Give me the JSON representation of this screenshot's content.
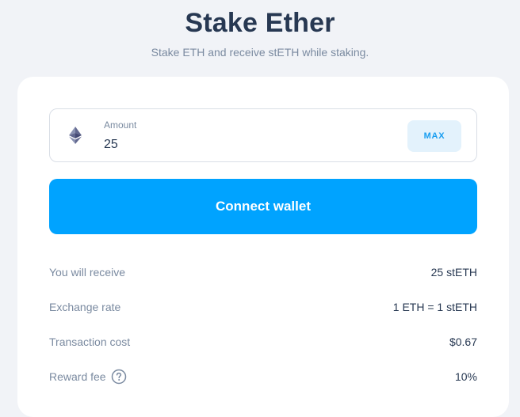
{
  "header": {
    "title": "Stake Ether",
    "subtitle": "Stake ETH and receive stETH while staking."
  },
  "amount": {
    "label": "Amount",
    "value": "25",
    "token_icon": "ethereum-icon",
    "max_label": "MAX"
  },
  "actions": {
    "connect_label": "Connect wallet"
  },
  "info": {
    "rows": [
      {
        "label": "You will receive",
        "value": "25 stETH"
      },
      {
        "label": "Exchange rate",
        "value": "1 ETH = 1 stETH"
      },
      {
        "label": "Transaction cost",
        "value": "$0.67"
      },
      {
        "label": "Reward fee",
        "value": "10%",
        "help_icon": "question-circle-icon"
      }
    ]
  },
  "colors": {
    "background": "#f1f3f7",
    "card": "#ffffff",
    "primary": "#00a3ff",
    "max_bg": "#e3f2fc",
    "title": "#273852",
    "muted": "#7a8aa0"
  }
}
